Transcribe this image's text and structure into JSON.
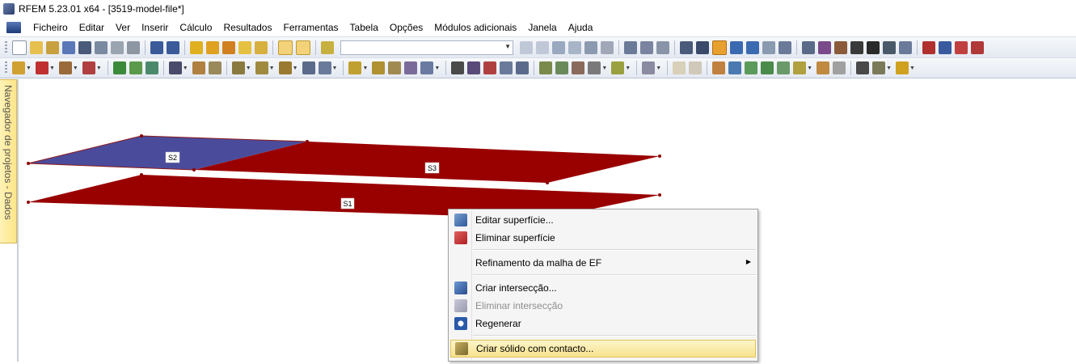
{
  "window": {
    "title": "RFEM 5.23.01 x64 - [3519-model-file*]"
  },
  "menu": [
    "Ficheiro",
    "Editar",
    "Ver",
    "Inserir",
    "Cálculo",
    "Resultados",
    "Ferramentas",
    "Tabela",
    "Opções",
    "Módulos adicionais",
    "Janela",
    "Ajuda"
  ],
  "sidepanel": {
    "label": "Navegador de projetos - Dados"
  },
  "surfaces": {
    "s1": "S1",
    "s2": "S2",
    "s3": "S3"
  },
  "colors": {
    "surface_red": "#990000",
    "surface_blue": "#4b4b9b",
    "node": "#8b0000"
  },
  "context_menu": {
    "edit_surface": "Editar superfície...",
    "delete_surface": "Eliminar superfície",
    "fe_mesh_refinement": "Refinamento da malha de EF",
    "create_intersection": "Criar intersecção...",
    "delete_intersection": "Eliminar intersecção",
    "regenerate": "Regenerar",
    "create_contact_solid": "Criar sólido com contacto..."
  }
}
